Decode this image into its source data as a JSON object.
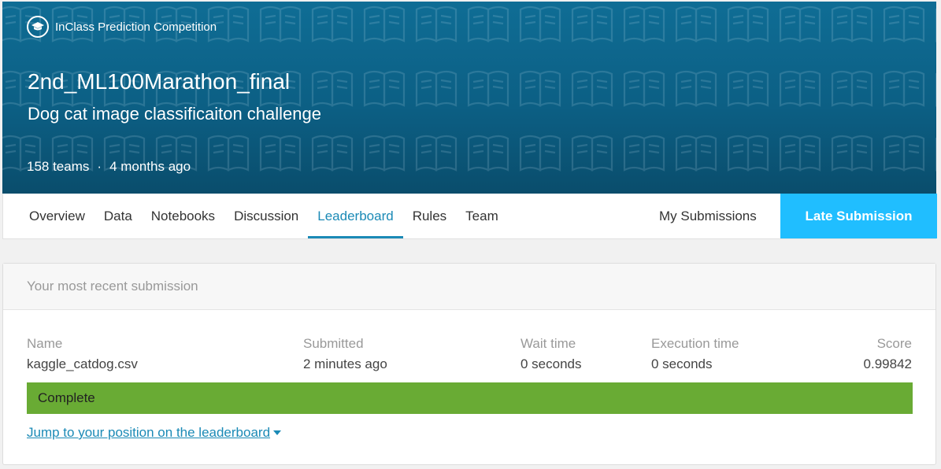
{
  "header": {
    "competition_type": "InClass Prediction Competition",
    "title": "2nd_ML100Marathon_final",
    "subtitle": "Dog cat image classificaiton challenge",
    "teams": "158 teams",
    "separator": "·",
    "age": "4 months ago",
    "icon": "graduation-cap-icon",
    "pattern_icon": "open-book-icon",
    "colors": {
      "banner": "#0c5f84"
    }
  },
  "nav": {
    "tabs": [
      {
        "label": "Overview"
      },
      {
        "label": "Data"
      },
      {
        "label": "Notebooks"
      },
      {
        "label": "Discussion"
      },
      {
        "label": "Leaderboard",
        "active": true
      },
      {
        "label": "Rules"
      },
      {
        "label": "Team"
      }
    ],
    "my_submissions": "My Submissions",
    "late_submission": "Late Submission",
    "colors": {
      "active_tab": "#1b8ab6",
      "late_button": "#20beff"
    }
  },
  "submission": {
    "heading": "Your most recent submission",
    "columns": {
      "name": {
        "label": "Name",
        "value": "kaggle_catdog.csv"
      },
      "submitted": {
        "label": "Submitted",
        "value": "2 minutes ago"
      },
      "wait": {
        "label": "Wait time",
        "value": "0 seconds"
      },
      "execution": {
        "label": "Execution time",
        "value": "0 seconds"
      },
      "score": {
        "label": "Score",
        "value": "0.99842"
      }
    },
    "status": "Complete",
    "status_color": "#69ab34",
    "jump_link": "Jump to your position on the leaderboard",
    "jump_icon": "caret-down-icon"
  }
}
